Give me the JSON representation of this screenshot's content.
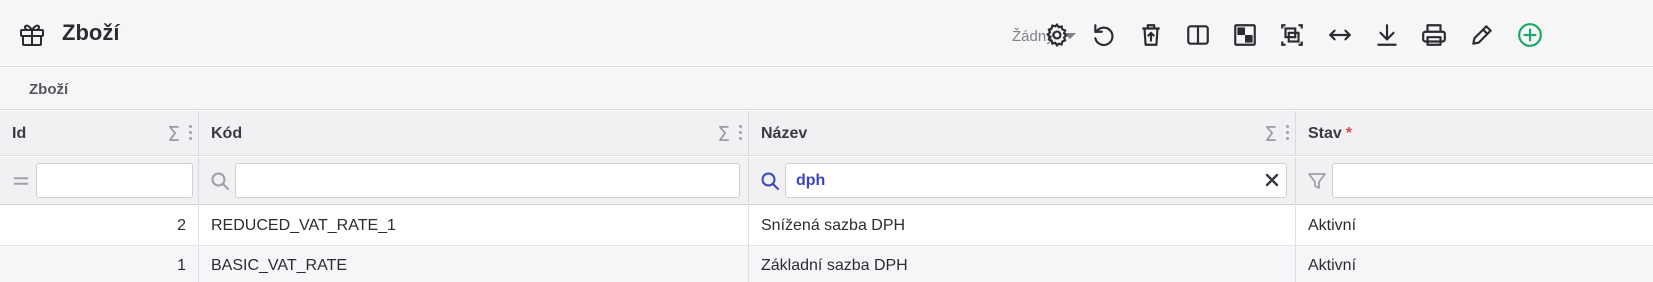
{
  "header": {
    "title": "Zboží",
    "app_icon": "box-gift-icon",
    "preset_label": "Žádný"
  },
  "toolbar": [
    {
      "name": "settings-gear-icon"
    },
    {
      "name": "refresh-undo-icon"
    },
    {
      "name": "delete-restore-icon"
    },
    {
      "name": "split-view-icon"
    },
    {
      "name": "highlight-cells-icon"
    },
    {
      "name": "select-frame-icon"
    },
    {
      "name": "fit-width-arrows-icon"
    },
    {
      "name": "download-icon"
    },
    {
      "name": "print-icon"
    },
    {
      "name": "edit-pencil-icon"
    },
    {
      "name": "add-circle-icon",
      "color": "#1aa865"
    }
  ],
  "breadcrumb": "Zboží",
  "columns": [
    {
      "label": "Id",
      "required": false,
      "filter_icon": "equals-icon",
      "filter_value": ""
    },
    {
      "label": "Kód",
      "required": false,
      "filter_icon": "search-icon",
      "filter_value": ""
    },
    {
      "label": "Název",
      "required": false,
      "filter_icon": "search-icon",
      "filter_value": "dph"
    },
    {
      "label": "Stav",
      "required": true,
      "required_mark": "*",
      "filter_icon": "funnel-icon",
      "filter_value": ""
    }
  ],
  "rows": [
    {
      "id": "2",
      "kod": "REDUCED_VAT_RATE_1",
      "nazev": "Snížená sazba DPH",
      "stav": "Aktivní"
    },
    {
      "id": "1",
      "kod": "BASIC_VAT_RATE",
      "nazev": "Základní sazba DPH",
      "stav": "Aktivní"
    }
  ],
  "colors": {
    "accent_search": "#3b46c0",
    "required": "#e0454b",
    "add": "#1aa865"
  }
}
